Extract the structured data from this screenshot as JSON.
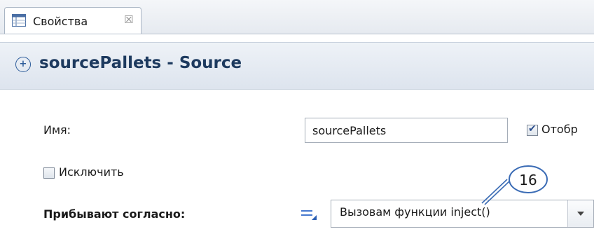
{
  "tab": {
    "label": "Свойства",
    "close": "☒"
  },
  "header": {
    "title": "sourcePallets - Source",
    "icon": "source-arrow-icon"
  },
  "form": {
    "name_label": "Имя:",
    "name_value": "sourcePallets",
    "show_name_label": "Отобр",
    "show_name_checked": true,
    "exclude_label": "Исключить",
    "exclude_checked": false,
    "arrive_label": "Прибывают согласно:",
    "arrive_value": "Вызовам функции inject()"
  },
  "callout": {
    "number": "16"
  }
}
